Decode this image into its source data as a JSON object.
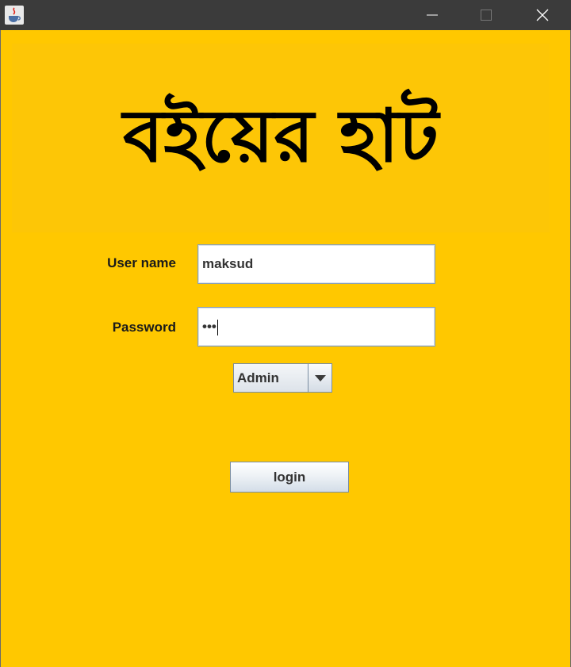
{
  "window": {
    "app_icon": "java-coffee-icon",
    "controls": [
      "minimize-icon",
      "maximize-icon",
      "close-icon"
    ]
  },
  "banner": {
    "title": "বইয়ের হাট"
  },
  "form": {
    "username_label": "User name",
    "username_value": "maksud",
    "password_label": "Password",
    "password_value": "•••",
    "role_selected": "Admin",
    "login_label": "login"
  },
  "colors": {
    "background": "#ffc800",
    "titlebar": "#3b3b3b"
  }
}
